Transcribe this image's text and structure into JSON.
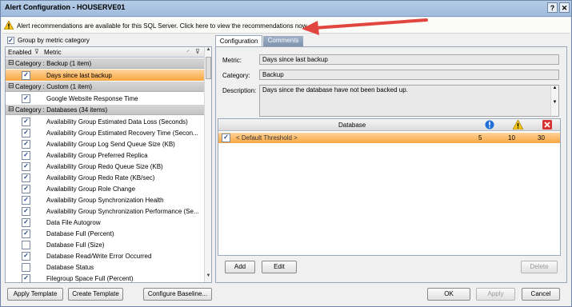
{
  "window": {
    "title": "Alert Configuration - HOUSERVE01",
    "help_label": "?",
    "close_label": "✕"
  },
  "recommendation": {
    "text": "Alert recommendations are available for this SQL Server. Click here to view the recommendations now."
  },
  "group_by": {
    "label": "Group by metric category",
    "checked": true
  },
  "left_grid": {
    "col_enabled": "Enabled",
    "col_metric": "Metric",
    "categories": [
      {
        "label": "Category : Backup (1 item)",
        "items": [
          {
            "name": "Days since last backup",
            "checked": true,
            "selected": true
          }
        ]
      },
      {
        "label": "Category : Custom (1 item)",
        "items": [
          {
            "name": "Google Website Response Time",
            "checked": true
          }
        ]
      },
      {
        "label": "Category : Databases (34 items)",
        "items": [
          {
            "name": "Availability Group Estimated Data Loss (Seconds)",
            "checked": true
          },
          {
            "name": "Availability Group Estimated Recovery Time (Secon...",
            "checked": true
          },
          {
            "name": "Availability Group Log Send Queue Size (KB)",
            "checked": true
          },
          {
            "name": "Availability Group Preferred Replica",
            "checked": true
          },
          {
            "name": "Availability Group Redo Queue Size (KB)",
            "checked": true
          },
          {
            "name": "Availability Group Redo Rate (KB/sec)",
            "checked": true
          },
          {
            "name": "Availability Group Role Change",
            "checked": true
          },
          {
            "name": "Availability Group Synchronization Health",
            "checked": true
          },
          {
            "name": "Availability Group Synchronization Performance (Se...",
            "checked": true
          },
          {
            "name": "Data File Autogrow",
            "checked": true
          },
          {
            "name": "Database Full (Percent)",
            "checked": true
          },
          {
            "name": "Database Full (Size)",
            "checked": false
          },
          {
            "name": "Database Read/Write Error Occurred",
            "checked": true
          },
          {
            "name": "Database Status",
            "checked": false
          },
          {
            "name": "Filegroup Space Full (Percent)",
            "checked": true
          }
        ]
      }
    ]
  },
  "tabs": [
    {
      "label": "Configuration",
      "active": true
    },
    {
      "label": "Comments",
      "active": false
    }
  ],
  "config": {
    "metric_label": "Metric:",
    "metric_value": "Days since last backup",
    "category_label": "Category:",
    "category_value": "Backup",
    "description_label": "Description:",
    "description_value": "Days since the database have not been backed up."
  },
  "thresholds": {
    "col_database": "Database",
    "rows": [
      {
        "name": "< Default Threshold >",
        "checked": true,
        "informational": "5",
        "warning": "10",
        "critical": "30"
      }
    ]
  },
  "buttons": {
    "add": "Add",
    "edit": "Edit",
    "delete": "Delete",
    "apply_template": "Apply Template",
    "create_template": "Create Template",
    "configure_baseline": "Configure Baseline...",
    "ok": "OK",
    "apply": "Apply",
    "cancel": "Cancel"
  },
  "colors": {
    "selection": "#f9a641",
    "arrow": "#e0463f",
    "title_bar": "#b7cde6"
  },
  "icons": {
    "warning": "warning-icon",
    "info": "info-icon",
    "critical": "critical-icon",
    "filter": "filter-icon"
  }
}
